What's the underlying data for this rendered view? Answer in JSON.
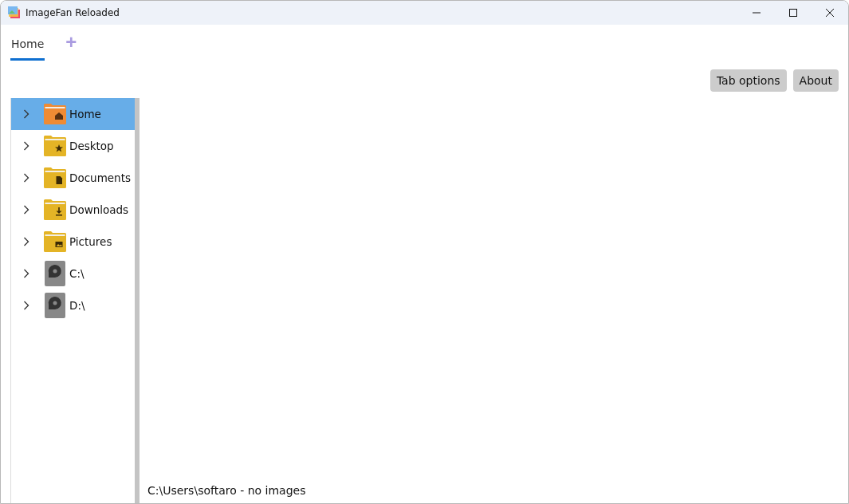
{
  "window": {
    "title": "ImageFan Reloaded"
  },
  "tabs": [
    {
      "label": "Home",
      "selected": true
    }
  ],
  "add_tab": {
    "label": "+"
  },
  "buttons": [
    "Tab options",
    "About"
  ],
  "tree": [
    {
      "label": "Home",
      "kind": "home",
      "selected": true
    },
    {
      "label": "Desktop",
      "kind": "star",
      "selected": false
    },
    {
      "label": "Documents",
      "kind": "document",
      "selected": false
    },
    {
      "label": "Downloads",
      "kind": "download",
      "selected": false
    },
    {
      "label": "Pictures",
      "kind": "picture",
      "selected": false
    },
    {
      "label": "C:\\",
      "kind": "drive",
      "selected": false
    },
    {
      "label": "D:\\",
      "kind": "drive",
      "selected": false
    }
  ],
  "status_bar": "C:\\Users\\softaro - no images"
}
